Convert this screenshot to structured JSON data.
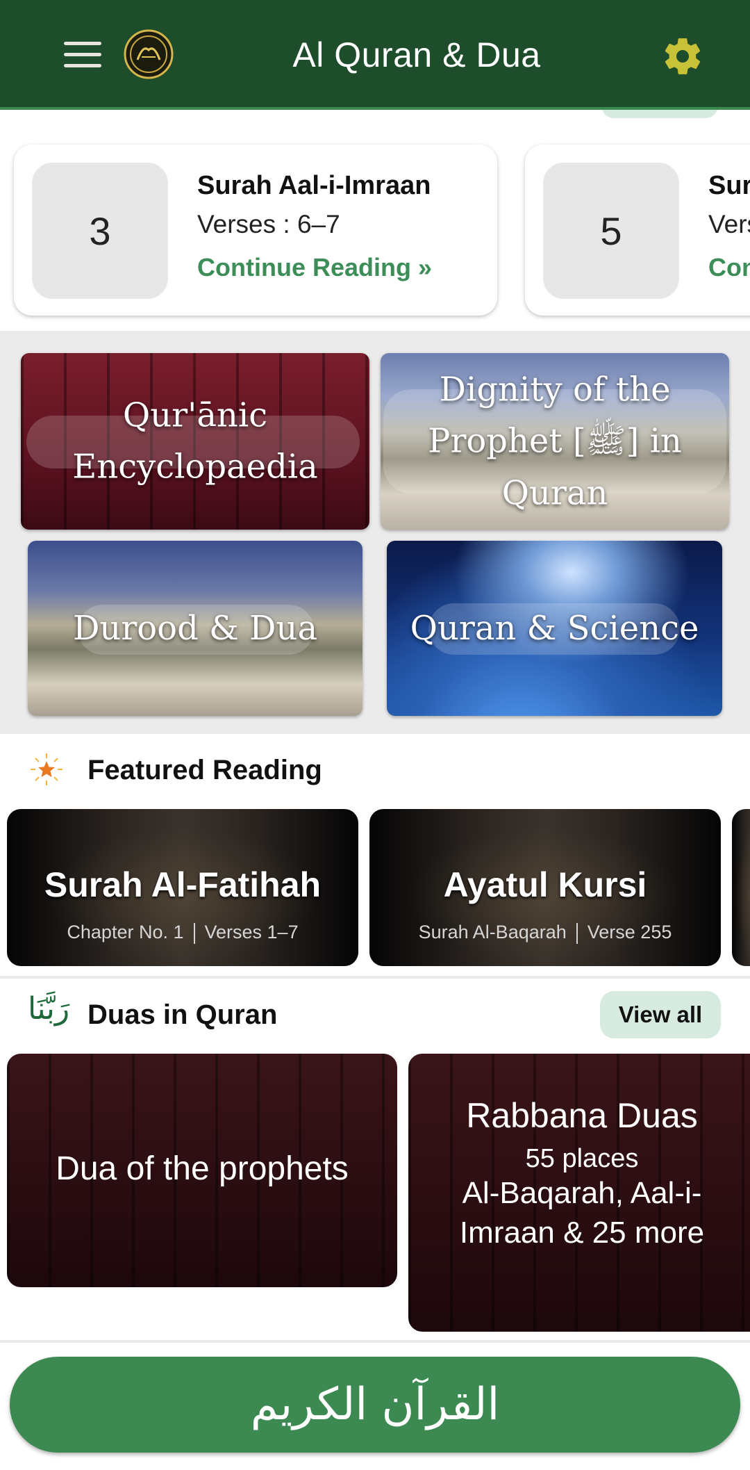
{
  "header": {
    "title": "Al Quran & Dua",
    "menu_icon": "hamburger-menu-icon",
    "logo_icon": "quran-logo-icon",
    "settings_icon": "gear-icon",
    "background": "#1e4d2b"
  },
  "recent": {
    "cards": [
      {
        "number": "3",
        "surah": "Surah Aal-i-Imraan",
        "verses": "Verses : 6–7",
        "continue_label": "Continue Reading »"
      },
      {
        "number": "5",
        "surah": "Surah",
        "verses": "Verses",
        "continue_label": "Continue"
      }
    ]
  },
  "tiles": [
    {
      "label": "Qur'ānic Encyclopaedia"
    },
    {
      "label": "Dignity of the Prophet [ﷺ] in Quran"
    },
    {
      "label": "Durood & Dua"
    },
    {
      "label": "Quran & Science"
    }
  ],
  "featured": {
    "icon": "star-icon",
    "title": "Featured Reading",
    "cards": [
      {
        "title": "Surah Al-Fatihah",
        "sub_a": "Chapter No. 1",
        "sub_b": "Verses 1–7"
      },
      {
        "title": "Ayatul Kursi",
        "sub_a": "Surah Al-Baqarah",
        "sub_b": "Verse 255"
      }
    ]
  },
  "duas": {
    "icon_text": "رَبَّنَا",
    "title": "Duas in Quran",
    "view_all": "View all",
    "cards": [
      {
        "title": "Dua of the prophets"
      },
      {
        "title": "Rabbana Duas",
        "count": "55 places",
        "surahs": "Al-Baqarah, Aal-i-Imraan & 25 more"
      }
    ]
  },
  "bottom": {
    "quran_button": "القرآن الكريم",
    "accent": "#3c8a52"
  }
}
